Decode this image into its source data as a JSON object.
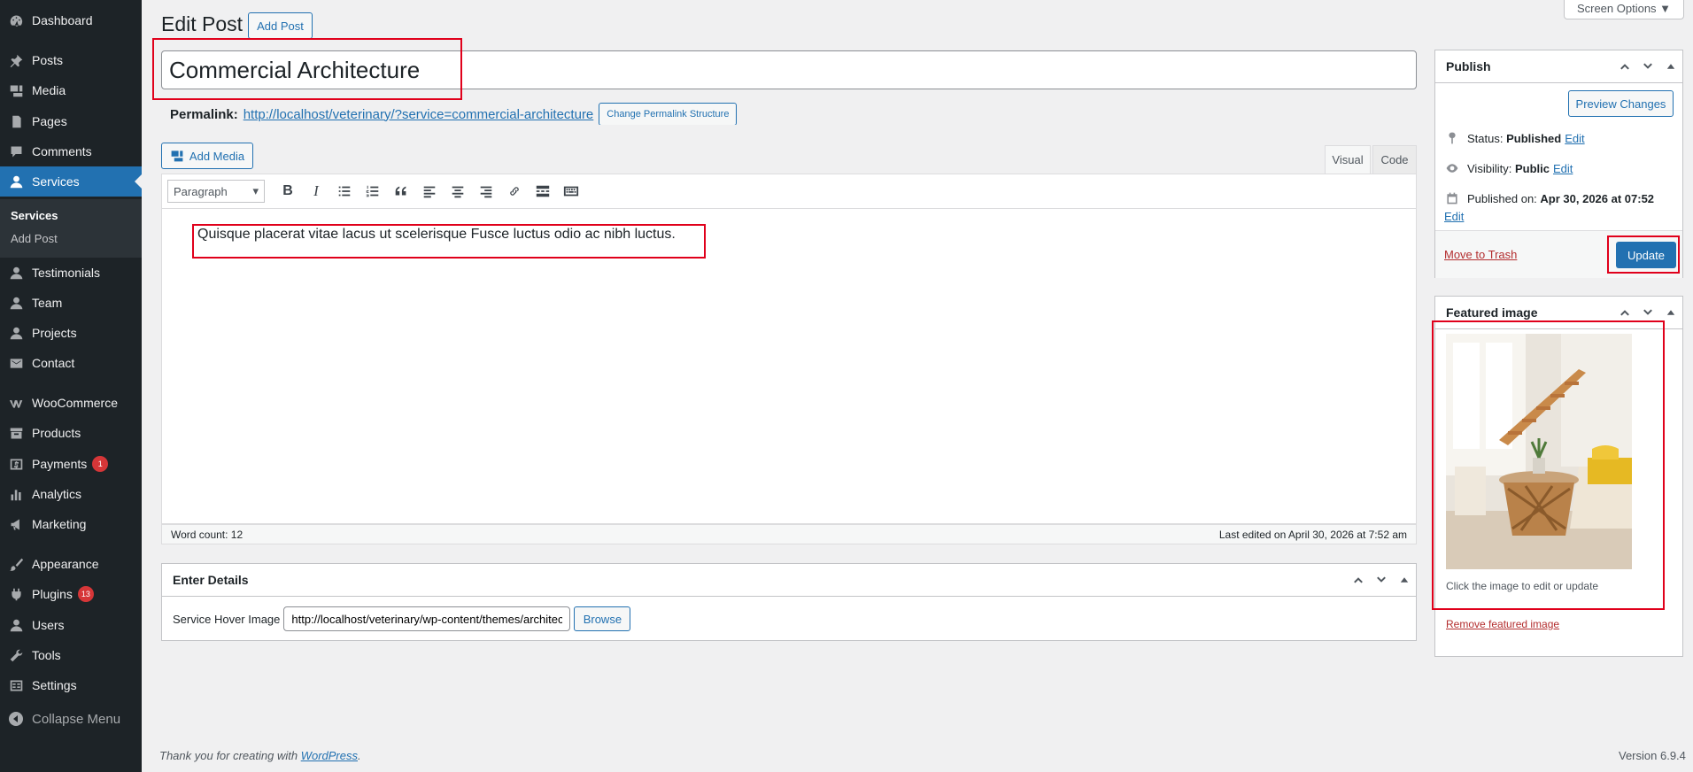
{
  "sidebar": {
    "items": [
      {
        "label": "Dashboard",
        "icon": "dashboard-icon"
      },
      {
        "label": "Posts",
        "icon": "pin-icon"
      },
      {
        "label": "Media",
        "icon": "media-icon"
      },
      {
        "label": "Pages",
        "icon": "pages-icon"
      },
      {
        "label": "Comments",
        "icon": "comment-icon"
      },
      {
        "label": "Services",
        "icon": "user-icon"
      },
      {
        "label": "Testimonials",
        "icon": "user-icon"
      },
      {
        "label": "Team",
        "icon": "user-icon"
      },
      {
        "label": "Projects",
        "icon": "user-icon"
      },
      {
        "label": "Contact",
        "icon": "mail-icon"
      },
      {
        "label": "WooCommerce",
        "icon": "woo-icon"
      },
      {
        "label": "Products",
        "icon": "archive-icon"
      },
      {
        "label": "Payments",
        "icon": "dollar-icon",
        "badge": "1"
      },
      {
        "label": "Analytics",
        "icon": "bar-chart-icon"
      },
      {
        "label": "Marketing",
        "icon": "megaphone-icon"
      },
      {
        "label": "Appearance",
        "icon": "brush-icon"
      },
      {
        "label": "Plugins",
        "icon": "plug-icon",
        "badge": "13"
      },
      {
        "label": "Users",
        "icon": "user-icon"
      },
      {
        "label": "Tools",
        "icon": "wrench-icon"
      },
      {
        "label": "Settings",
        "icon": "settings-icon"
      }
    ],
    "submenu": [
      {
        "label": "Services"
      },
      {
        "label": "Add Post"
      }
    ],
    "collapse_label": "Collapse Menu"
  },
  "header": {
    "title": "Edit Post",
    "add_post_label": "Add Post",
    "screen_options_label": "Screen Options ▼"
  },
  "post": {
    "title": "Commercial Architecture",
    "permalink_label": "Permalink:",
    "permalink_url": "http://localhost/veterinary/?service=commercial-architecture",
    "change_permalink_label": "Change Permalink Structure"
  },
  "editor": {
    "add_media_label": "Add Media",
    "tab_visual": "Visual",
    "tab_code": "Code",
    "format_value": "Paragraph",
    "content": "Quisque placerat vitae lacus ut scelerisque Fusce luctus odio ac nibh luctus.",
    "word_count": "Word count: 12",
    "last_edited": "Last edited on April 30, 2026 at 7:52 am"
  },
  "details_box": {
    "title": "Enter Details",
    "field_label": "Service Hover Image",
    "field_value": "http://localhost/veterinary/wp-content/themes/architecture",
    "browse_label": "Browse"
  },
  "publish_box": {
    "title": "Publish",
    "preview_label": "Preview Changes",
    "status_label": "Status:",
    "status_value": "Published",
    "visibility_label": "Visibility:",
    "visibility_value": "Public",
    "published_on_label": "Published on:",
    "published_on_value": "Apr 30, 2026 at 07:52",
    "edit_label": "Edit",
    "trash_label": "Move to Trash",
    "update_label": "Update"
  },
  "featured_box": {
    "title": "Featured image",
    "hint": "Click the image to edit or update",
    "remove_label": "Remove featured image"
  },
  "footer": {
    "thanks_prefix": "Thank you for creating with",
    "wordpress_link": "WordPress",
    "thanks_suffix": ".",
    "version": "Version 6.9.4"
  }
}
